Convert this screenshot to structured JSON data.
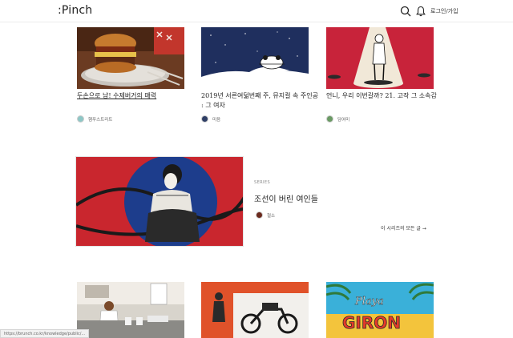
{
  "header": {
    "logo": ":Pinch",
    "search_icon": "search-icon",
    "bell_icon": "bell-icon",
    "login": "로그인/가입"
  },
  "cards": [
    {
      "title": "두손으로 냠! 수제버거의 매력",
      "author": "햄푸스트리트"
    },
    {
      "title_line1": "2019년 서른여덟번째 주, 뮤지컬 속 주인공",
      "title_line2": ": 그 여자",
      "author": "미음"
    },
    {
      "title": "언니, 우리 이번갈까? 21. 고작 그 소속감",
      "author": "담여미"
    }
  ],
  "series": {
    "tag": "SERIES",
    "title": "조선이 버린 여인들",
    "author": "철소",
    "more": "이 시리즈의 모든 글 →"
  },
  "bottom_cards": [
    {
      "label": "cafe-scene"
    },
    {
      "label": "motorcycle-scene"
    },
    {
      "label": "Playa Giron"
    }
  ],
  "bottom_card_text": {
    "playa": "Playa",
    "giron": "GIRON"
  },
  "status_bar": "https://brunch.co.kr/knowledge/public/...",
  "colors": {
    "burger_bg": "#6b3b22",
    "night_bg": "#1f2f5e",
    "red_bg": "#c8233a",
    "series_blue": "#1d3d8c",
    "series_red": "#c9262e"
  }
}
